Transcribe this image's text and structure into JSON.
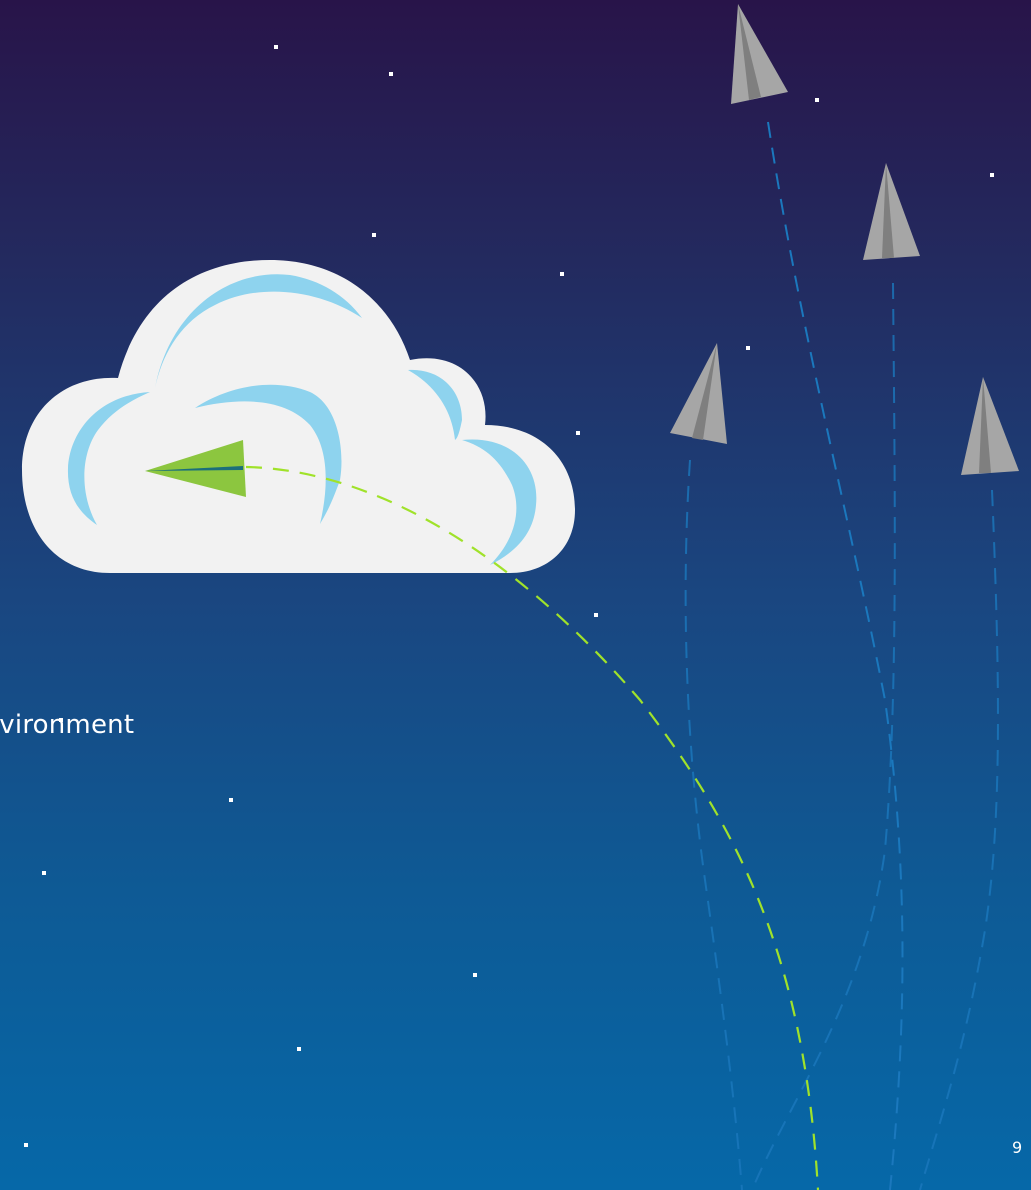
{
  "slide": {
    "body_text": "Environment",
    "page_number": "9"
  },
  "colors": {
    "background_top": "#281449",
    "background_bottom": "#0668a8",
    "cloud_fill": "#f2f2f2",
    "cloud_accent": "#8ed3ee",
    "active_plane": "#8cc63f",
    "active_trail": "#a0e22a",
    "inactive_plane": "#a6a6a6",
    "inactive_trail": "#1b78bd",
    "star": "#ffffff"
  },
  "icons": {
    "cloud": "cloud-icon",
    "active_plane": "paper-plane-green-icon",
    "inactive_planes": [
      "paper-plane-gray-icon",
      "paper-plane-gray-icon",
      "paper-plane-gray-icon",
      "paper-plane-gray-icon"
    ]
  }
}
